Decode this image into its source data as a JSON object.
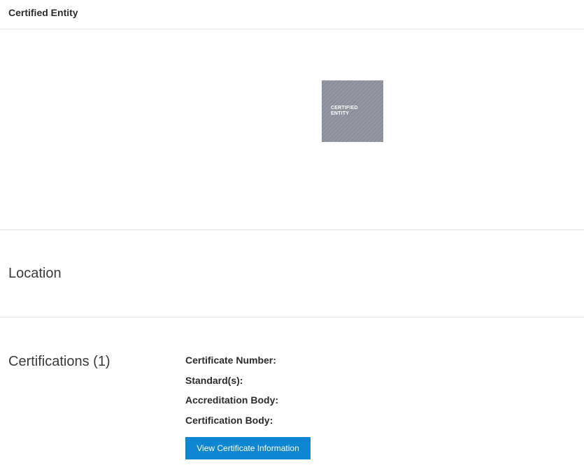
{
  "header": {
    "title": "Certified Entity"
  },
  "logo": {
    "text": "CERTIFIED\nENTITY",
    "background_color": "#8e939d"
  },
  "location": {
    "heading": "Location"
  },
  "certifications": {
    "heading": "Certifications (1)",
    "fields": [
      {
        "label": "Certificate Number:"
      },
      {
        "label": "Standard(s):"
      },
      {
        "label": "Accreditation Body:"
      },
      {
        "label": "Certification Body:"
      }
    ],
    "button_label": "View Certificate Information",
    "button_color": "#0f86d2"
  }
}
